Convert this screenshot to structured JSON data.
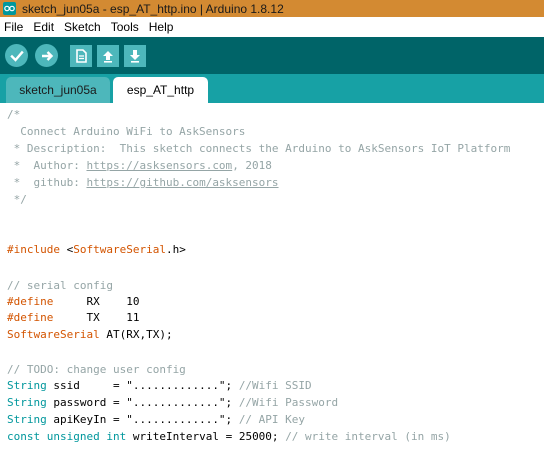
{
  "window": {
    "title": "sketch_jun05a - esp_AT_http.ino | Arduino 1.8.12"
  },
  "menu": {
    "items": [
      "File",
      "Edit",
      "Sketch",
      "Tools",
      "Help"
    ]
  },
  "toolbar": {
    "buttons": [
      {
        "name": "verify",
        "icon": "check-icon"
      },
      {
        "name": "upload",
        "icon": "arrow-right-icon"
      },
      {
        "name": "new",
        "icon": "document-icon"
      },
      {
        "name": "open",
        "icon": "arrow-up-icon"
      },
      {
        "name": "save",
        "icon": "arrow-down-icon"
      }
    ]
  },
  "tabs": [
    {
      "label": "sketch_jun05a",
      "active": false
    },
    {
      "label": "esp_AT_http",
      "active": true
    }
  ],
  "code": {
    "l1": "/*",
    "l2": "  Connect Arduino WiFi to AskSensors",
    "l3": " * Description:  This sketch connects the Arduino to AskSensors IoT Platform",
    "l4_pre": " *  Author: ",
    "l4_link": "https://asksensors.com",
    "l4_post": ", 2018",
    "l5_pre": " *  github: ",
    "l5_link": "https://github.com/asksensors",
    "l6": " */",
    "l7_kw": "#include",
    "l7_sp": " <",
    "l7_type": "SoftwareSerial",
    "l7_post": ".h>",
    "l8": "// serial config",
    "l9_kw": "#define",
    "l9_post": "     RX    10",
    "l10_kw": "#define",
    "l10_post": "     TX    11",
    "l11_type": "SoftwareSerial",
    "l11_post": " AT(RX,TX);",
    "l12": "// TODO: change user config",
    "l13_type": "String",
    "l13_mid": " ssid     = \".............\"; ",
    "l13_comment": "//Wifi SSID",
    "l14_type": "String",
    "l14_mid": " password = \".............\"; ",
    "l14_comment": "//Wifi Password",
    "l15_type": "String",
    "l15_mid": " apiKeyIn = \".............\"; ",
    "l15_comment": "// API Key",
    "l16_kw1": "const",
    "l16_sp1": " ",
    "l16_kw2": "unsigned",
    "l16_sp2": " ",
    "l16_kw3": "int",
    "l16_mid": " writeInterval = 25000; ",
    "l16_comment": "// write interval (in ms)"
  },
  "colors": {
    "titlebar": "#d38a32",
    "toolbar": "#006468",
    "tabbar": "#17a1a5",
    "button": "#4db7bb",
    "comment": "#95a5a6",
    "keyword": "#d35400",
    "type": "#00979c"
  }
}
